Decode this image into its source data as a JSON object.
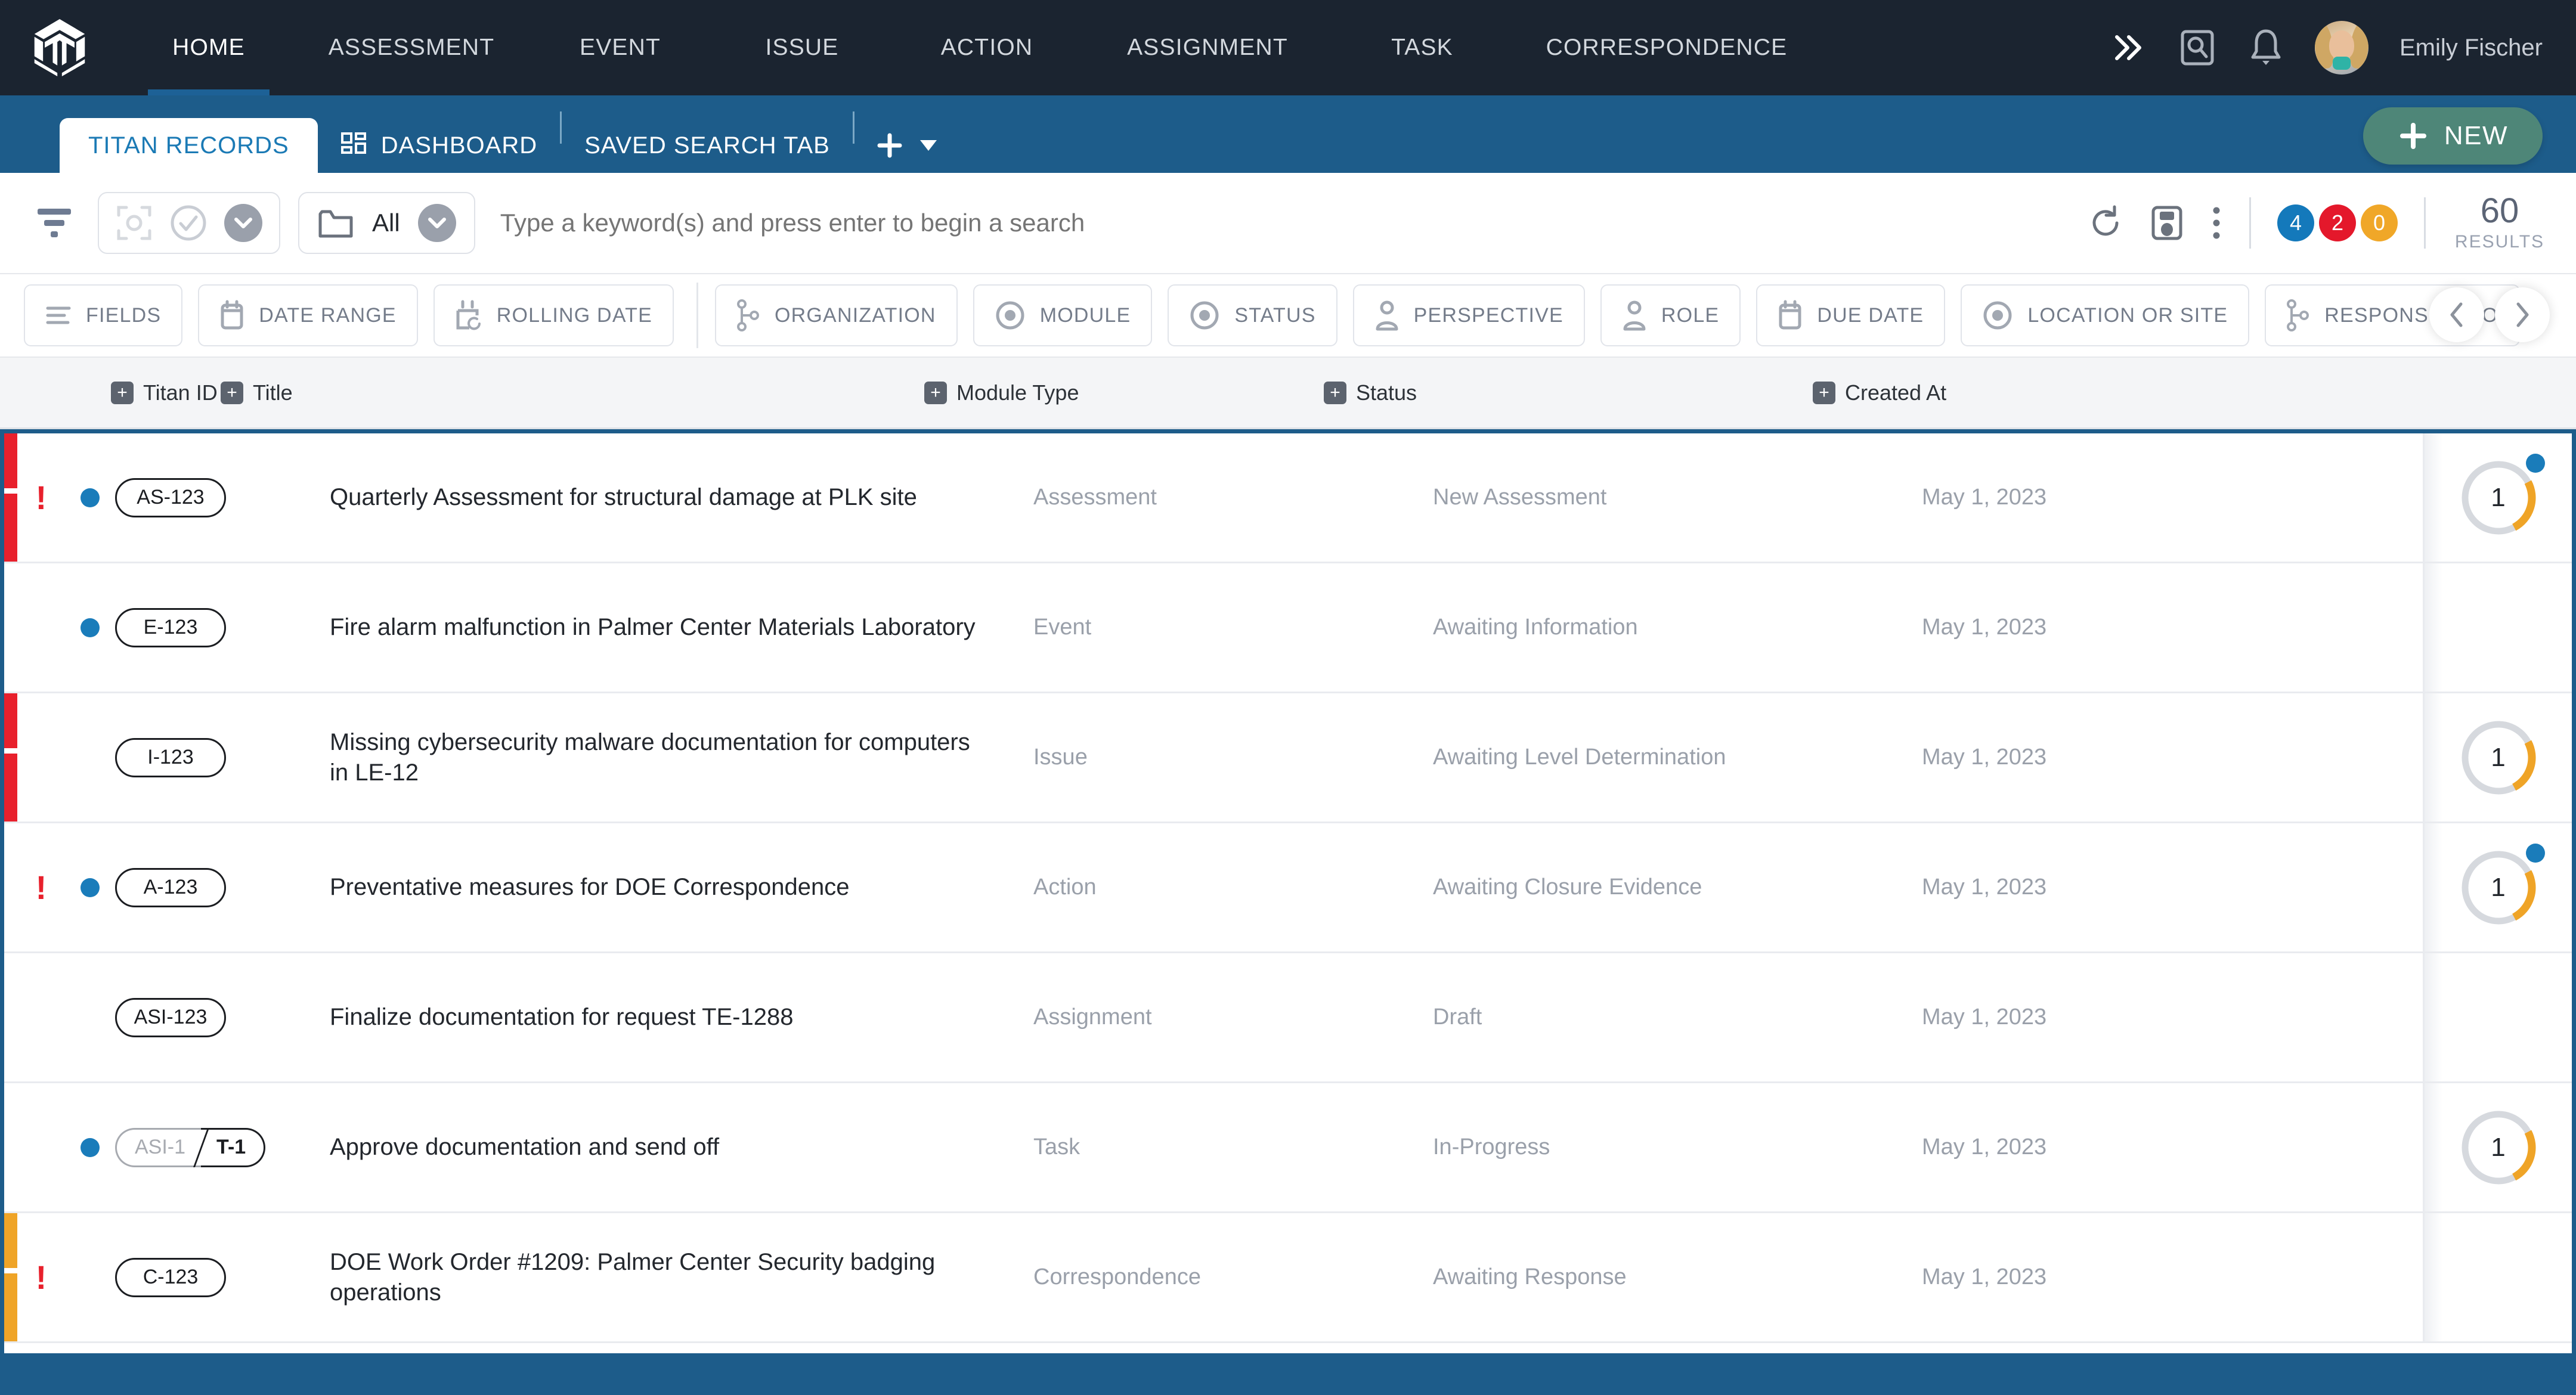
{
  "colors": {
    "nav_bg": "#1b2430",
    "tab_bg": "#1d5c8a",
    "accent_blue": "#1a7cba",
    "new_button": "#4e8678",
    "red": "#e8202c",
    "orange": "#efa427",
    "badge_blue": "#1479bb",
    "badge_red": "#e4182b",
    "badge_orange": "#f0a728"
  },
  "topnav": {
    "logo_icon": "titan-cube-logo",
    "items": [
      {
        "label": "HOME",
        "active": true
      },
      {
        "label": "ASSESSMENT",
        "active": false
      },
      {
        "label": "EVENT",
        "active": false
      },
      {
        "label": "ISSUE",
        "active": false
      },
      {
        "label": "ACTION",
        "active": false
      },
      {
        "label": "ASSIGNMENT",
        "active": false
      },
      {
        "label": "TASK",
        "active": false
      },
      {
        "label": "CORRESPONDENCE",
        "active": false
      }
    ],
    "overflow_icon": "chevron-double-right-icon",
    "search_icon": "search-box-icon",
    "notification_icon": "bell-icon",
    "user_name": "Emily Fischer",
    "avatar_icon": "user-avatar"
  },
  "tabbar": {
    "active_tab": "TITAN RECORDS",
    "dashboard_tab": "DASHBOARD",
    "dashboard_icon": "dashboard-grid-icon",
    "saved_search_tab": "SAVED SEARCH TAB",
    "add_tab_icon": "plus-icon",
    "add_tab_caret": "caret-down-icon",
    "new_button": "NEW",
    "new_button_icon": "plus-icon"
  },
  "searchbar": {
    "filter_icon": "filter-funnel-icon",
    "select_scan_icon": "scan-select-icon",
    "check_icon": "check-circle-icon",
    "select_caret_icon": "chevron-down-icon",
    "folder_icon": "folder-icon",
    "folder_label": "All",
    "folder_caret_icon": "chevron-down-icon",
    "placeholder": "Type a keyword(s) and press enter to begin a search",
    "value": "",
    "refresh_icon": "refresh-icon",
    "save_icon": "save-disk-icon",
    "more_icon": "kebab-menu-icon",
    "badges": [
      {
        "value": "4",
        "color": "#1479bb",
        "name": "badge-blue"
      },
      {
        "value": "2",
        "color": "#e4182b",
        "name": "badge-red"
      },
      {
        "value": "0",
        "color": "#f0a728",
        "name": "badge-orange"
      }
    ],
    "results_count": "60",
    "results_label": "RESULTS"
  },
  "chips": [
    {
      "label": "FIELDS",
      "icon": "lines-icon"
    },
    {
      "label": "DATE RANGE",
      "icon": "calendar-icon"
    },
    {
      "label": "ROLLING DATE",
      "icon": "calendar-refresh-icon"
    },
    {
      "label": "ORGANIZATION",
      "icon": "org-tree-icon"
    },
    {
      "label": "MODULE",
      "icon": "radio-target-icon"
    },
    {
      "label": "STATUS",
      "icon": "radio-target-icon"
    },
    {
      "label": "PERSPECTIVE",
      "icon": "person-icon"
    },
    {
      "label": "ROLE",
      "icon": "person-icon"
    },
    {
      "label": "DUE DATE",
      "icon": "calendar-icon"
    },
    {
      "label": "LOCATION OR SITE",
      "icon": "radio-target-icon"
    },
    {
      "label": "RESPONSIBLE O",
      "icon": "org-tree-icon"
    }
  ],
  "chip_nav": {
    "prev_icon": "chevron-left-icon",
    "next_icon": "chevron-right-icon"
  },
  "table": {
    "columns": [
      {
        "label": "Titan ID"
      },
      {
        "label": "Title"
      },
      {
        "label": "Module Type"
      },
      {
        "label": "Status"
      },
      {
        "label": "Created At"
      }
    ],
    "rows": [
      {
        "accent": "#e8202c",
        "flag": "!",
        "dot": true,
        "id": "AS-123",
        "title": "Quarterly Assessment for structural damage at PLK site",
        "module": "Assessment",
        "status": "New Assessment",
        "created": "May 1, 2023",
        "progress": {
          "show": true,
          "value": "1",
          "percent": 25,
          "dot": true
        }
      },
      {
        "accent": "",
        "flag": "",
        "dot": true,
        "id": "E-123",
        "title": "Fire alarm malfunction in Palmer Center Materials Laboratory",
        "module": "Event",
        "status": "Awaiting Information",
        "created": "May 1, 2023",
        "progress": {
          "show": false,
          "value": "",
          "percent": 0,
          "dot": false
        }
      },
      {
        "accent": "#e8202c",
        "flag": "",
        "dot": false,
        "id": "I-123",
        "title": "Missing cybersecurity malware documentation for computers in LE-12",
        "module": "Issue",
        "status": "Awaiting Level Determination",
        "created": "May 1, 2023",
        "progress": {
          "show": true,
          "value": "1",
          "percent": 25,
          "dot": false
        }
      },
      {
        "accent": "",
        "flag": "!",
        "dot": true,
        "id": "A-123",
        "title": "Preventative measures for DOE Correspondence",
        "module": "Action",
        "status": "Awaiting Closure Evidence",
        "created": "May 1, 2023",
        "progress": {
          "show": true,
          "value": "1",
          "percent": 25,
          "dot": true
        }
      },
      {
        "accent": "",
        "flag": "",
        "dot": false,
        "id": "ASI-123",
        "title": "Finalize documentation for request TE-1288",
        "module": "Assignment",
        "status": "Draft",
        "created": "May 1, 2023",
        "progress": {
          "show": false,
          "value": "",
          "percent": 0,
          "dot": false
        }
      },
      {
        "accent": "",
        "flag": "",
        "dot": true,
        "id_parent": "ASI-1",
        "id_child": "T-1",
        "split": true,
        "title": "Approve documentation and send off",
        "module": "Task",
        "status": "In-Progress",
        "created": "May 1, 2023",
        "progress": {
          "show": true,
          "value": "1",
          "percent": 25,
          "dot": false
        }
      },
      {
        "accent": "#efa427",
        "flag": "!",
        "dot": false,
        "id": "C-123",
        "title": "DOE Work Order #1209: Palmer Center Security badging operations",
        "module": "Correspondence",
        "status": "Awaiting Response",
        "created": "May 1, 2023",
        "progress": {
          "show": false,
          "value": "",
          "percent": 0,
          "dot": false
        }
      }
    ]
  }
}
